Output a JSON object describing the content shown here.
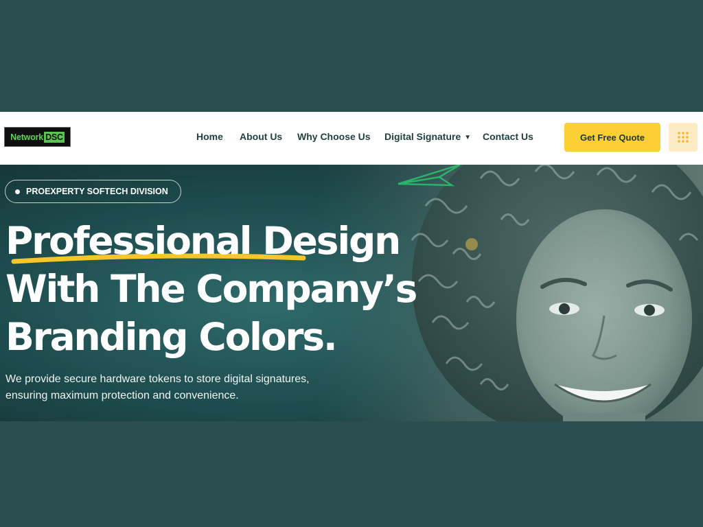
{
  "brand": {
    "logo_part1": "Network",
    "logo_part2": "DSC",
    "colors": {
      "primary": "#2b4e4f",
      "accent": "#fccf34",
      "logo_green": "#5fd15a"
    }
  },
  "nav": {
    "items": [
      {
        "label": "Home"
      },
      {
        "label": "About Us"
      },
      {
        "label": "Why Choose Us"
      },
      {
        "label": "Digital Signature",
        "icon": "chevron-down-icon"
      },
      {
        "label": "Contact Us"
      }
    ]
  },
  "header": {
    "cta_label": "Get Free Quote",
    "menu_icon": "grid-dots-icon"
  },
  "hero": {
    "badge": "PROEXPERTY SOFTECH DIVISION",
    "headline": [
      "Professional Design",
      "With The Company’s",
      "Branding Colors."
    ],
    "description_line1": "We provide secure hardware tokens to store digital signatures,",
    "description_line2": "ensuring maximum protection and convenience.",
    "image": "smiling-woman-curly-hair-photo"
  }
}
